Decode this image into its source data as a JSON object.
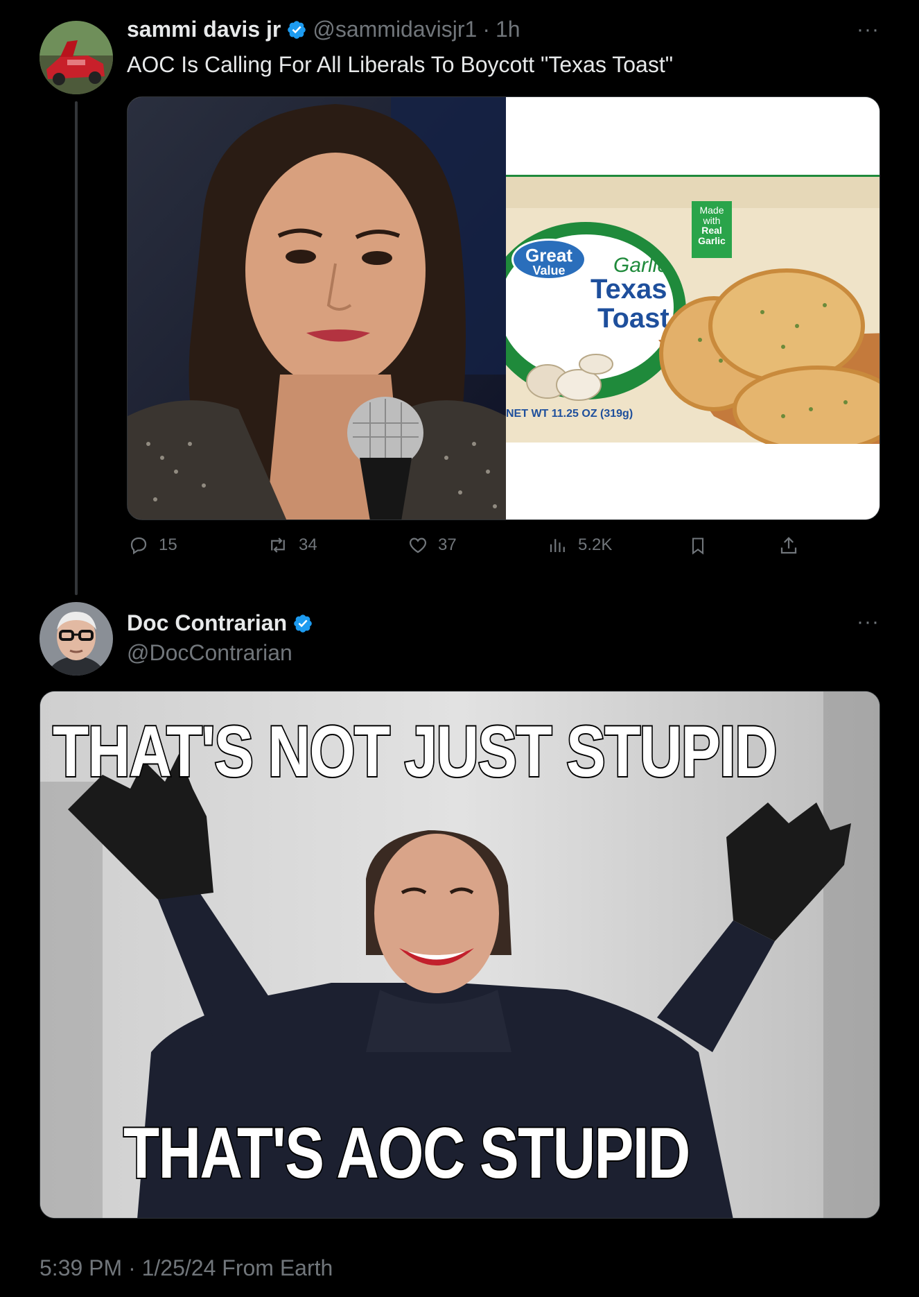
{
  "tweet1": {
    "display_name": "sammi davis jr",
    "handle": "@sammidavisjr1",
    "separator": "·",
    "time": "1h",
    "more": "···",
    "text": "AOC Is Calling For All Liberals To Boycott \"Texas Toast\"",
    "product": {
      "brand_line1": "Great",
      "brand_line2": "Value",
      "flavor": "Garlic",
      "name_line1": "Texas",
      "name_line2": "Toast",
      "badge_line1": "Made",
      "badge_line2": "with",
      "badge_line3": "Real",
      "badge_line4": "Garlic",
      "net_wt": "NET WT 11.25 OZ (319g)"
    },
    "actions": {
      "replies": "15",
      "reposts": "34",
      "likes": "37",
      "views": "5.2K"
    }
  },
  "tweet2": {
    "display_name": "Doc Contrarian",
    "handle": "@DocContrarian",
    "more": "···",
    "meme_top": "THAT'S NOT JUST STUPID",
    "meme_bottom": "THAT'S AOC STUPID"
  },
  "footer": {
    "timestamp": "5:39 PM · 1/25/24 From Earth"
  },
  "colors": {
    "background": "#000000",
    "text_primary": "#e7e9ea",
    "text_secondary": "#71767b",
    "verified": "#1d9bf0",
    "walmart_green": "#1f8a3b"
  }
}
